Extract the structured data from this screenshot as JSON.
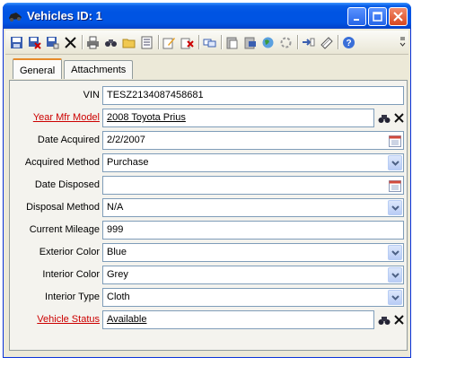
{
  "window": {
    "title": "Vehicles ID: 1"
  },
  "toolbar": {
    "icons": [
      "save-icon",
      "save-close-icon",
      "save-new-icon",
      "delete-icon",
      "print-icon",
      "find-icon",
      "folder-icon",
      "list-icon",
      "edit-icon",
      "refresh-icon",
      "copy-icon",
      "paste-icon",
      "web-icon",
      "sync-icon",
      "import-icon",
      "export-icon",
      "help-icon"
    ]
  },
  "tabs": [
    {
      "label": "General",
      "active": true
    },
    {
      "label": "Attachments",
      "active": false
    }
  ],
  "form": {
    "vin": {
      "label": "VIN",
      "value": "TESZ2134087458681"
    },
    "year_mfr_model": {
      "label": "Year Mfr Model",
      "value": "2008 Toyota Prius"
    },
    "date_acquired": {
      "label": "Date Acquired",
      "value": "2/2/2007"
    },
    "acquired_method": {
      "label": "Acquired Method",
      "value": "Purchase"
    },
    "date_disposed": {
      "label": "Date Disposed",
      "value": ""
    },
    "disposal_method": {
      "label": "Disposal Method",
      "value": "N/A"
    },
    "current_mileage": {
      "label": "Current Mileage",
      "value": "999"
    },
    "exterior_color": {
      "label": "Exterior Color",
      "value": "Blue"
    },
    "interior_color": {
      "label": "Interior Color",
      "value": "Grey"
    },
    "interior_type": {
      "label": "Interior Type",
      "value": "Cloth"
    },
    "vehicle_status": {
      "label": "Vehicle Status",
      "value": "Available"
    }
  },
  "colors": {
    "title_bar": "#0054e3",
    "link_label": "#cc0000",
    "tab_highlight": "#e68b2c"
  }
}
